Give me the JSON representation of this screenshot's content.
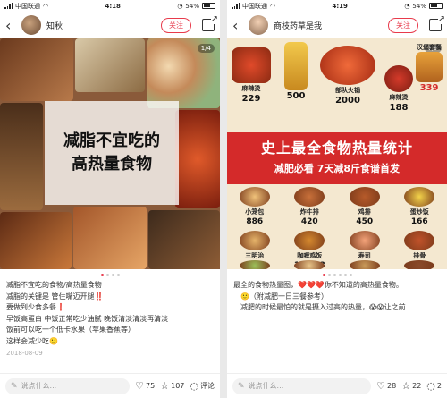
{
  "left": {
    "status": {
      "carrier": "中国联通",
      "time": "4:18",
      "battery": "54%"
    },
    "author": {
      "name": "知秋"
    },
    "follow_label": "关注",
    "counter": "1/4",
    "overlay": {
      "line1": "减脂不宜吃的",
      "line2": "高热量食物"
    },
    "body_lines": [
      "减脂不宜吃的食物/高热量食物",
      "减脂的关键是 管住嘴迈开腿‼️",
      "要做到少食多餐❗",
      "早饭高蛋白 中饭正常吃少油腻 晚饭清淡清淡再清淡",
      "饭前可以吃一个低卡水果（苹果香蕉等）",
      "这样会减少吃🙂"
    ],
    "date": "2018-08-09",
    "bottom": {
      "placeholder": "说点什么...",
      "likes": "75",
      "stars": "107",
      "comments_label": "评论"
    }
  },
  "right": {
    "status": {
      "carrier": "中国联通",
      "time": "4:19",
      "battery": "54%"
    },
    "author": {
      "name": "商枝药草是我"
    },
    "follow_label": "关注",
    "counter": "1/8",
    "banner": {
      "title": "史上最全食物热量统计",
      "subtitle": "减肥必看 7天减8斤食谱首发"
    },
    "top_foods": [
      {
        "name": "麻辣烫",
        "value": "229"
      },
      {
        "name": "",
        "value": "500"
      },
      {
        "name": "部队火锅",
        "value": "2000"
      },
      {
        "name": "麻辣烫",
        "value": "188"
      },
      {
        "name": "汉堡套餐",
        "value": "339"
      }
    ],
    "foods": [
      {
        "name": "小笼包",
        "value": "886"
      },
      {
        "name": "炸牛排",
        "value": "420"
      },
      {
        "name": "鸡排",
        "value": "450"
      },
      {
        "name": "蛋炒饭",
        "value": "166"
      },
      {
        "name": "三明治",
        "value": "268"
      },
      {
        "name": "咖喱鸡饭",
        "value": "126.88"
      },
      {
        "name": "寿司",
        "value": "166"
      },
      {
        "name": "排骨",
        "value": "260"
      },
      {
        "name": "",
        "value": ""
      },
      {
        "name": "",
        "value": ""
      },
      {
        "name": "",
        "value": ""
      },
      {
        "name": "",
        "value": ""
      }
    ],
    "body_lines": [
      "最全的食物热量图，❤️❤️❤️你不知道的高热量食物。",
      "🙂（附减肥一日三餐参考）",
      "减肥的时候最怕的就是摄入过高的热量，😱😱让之前"
    ],
    "bottom": {
      "placeholder": "说点什么...",
      "likes": "28",
      "stars": "22",
      "comments": "2"
    }
  },
  "colors": {
    "accent": "#e83a4b",
    "banner": "#d42a2a"
  },
  "icons": [
    "back-arrow-icon",
    "share-icon",
    "heart-icon",
    "star-icon",
    "comment-icon",
    "pen-icon",
    "signal-icon",
    "wifi-icon",
    "battery-icon"
  ]
}
